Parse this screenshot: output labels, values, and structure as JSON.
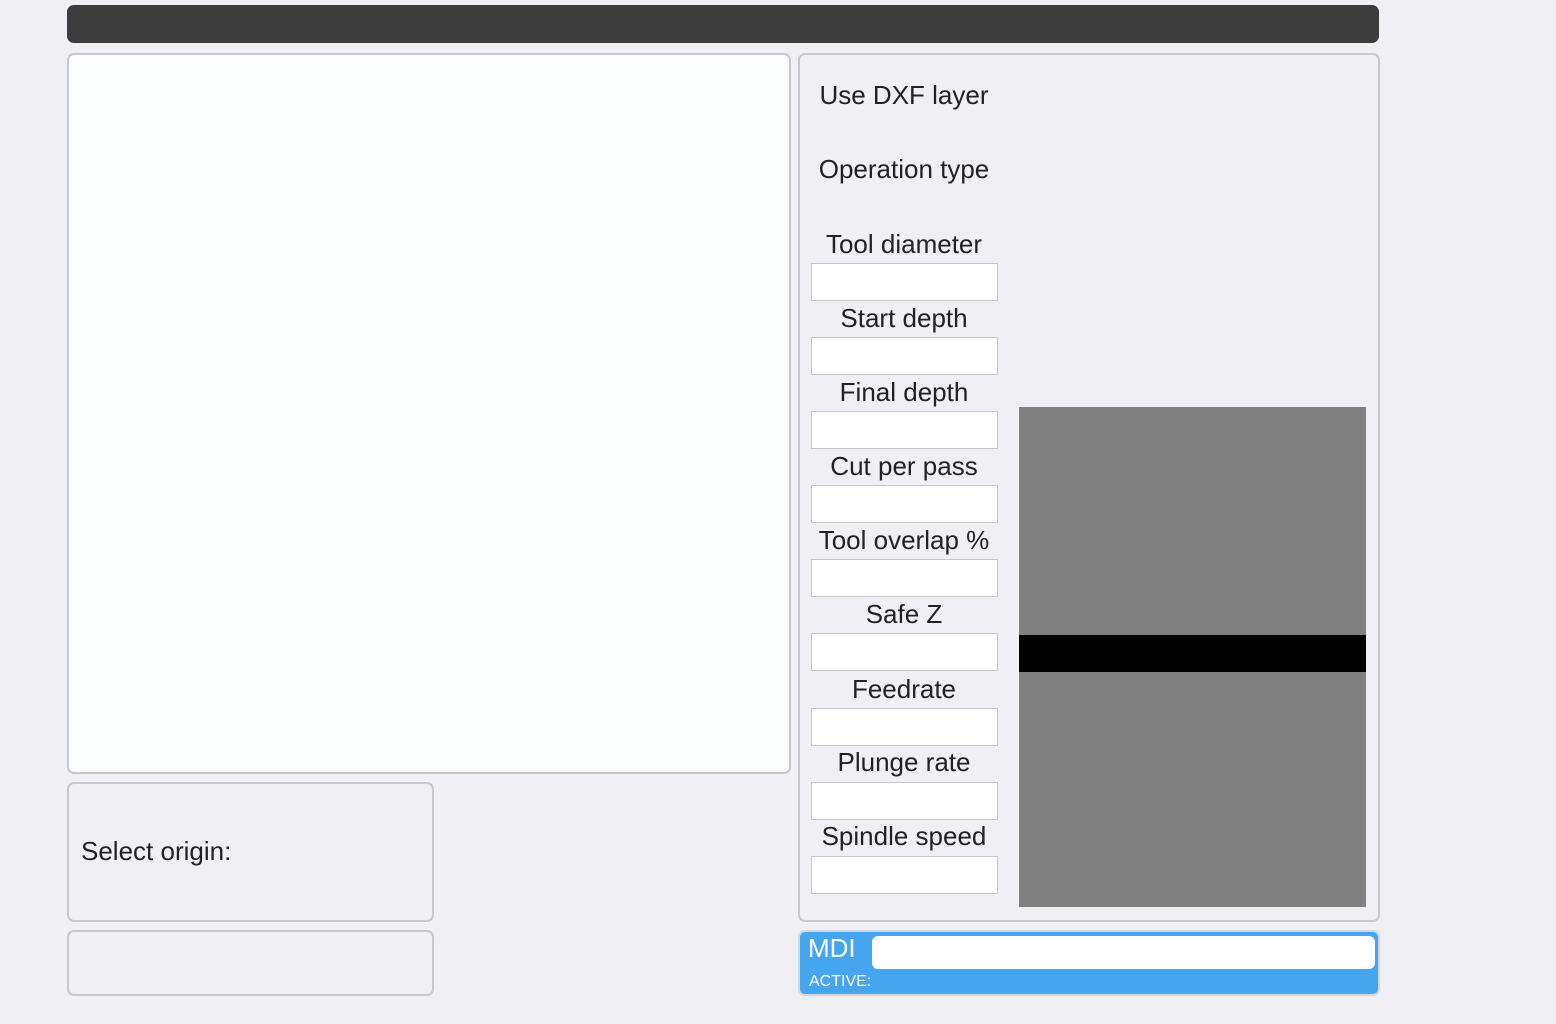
{
  "header": {},
  "origin": {
    "label": "Select origin:"
  },
  "settings": {
    "fields": [
      {
        "label": "Use DXF layer"
      },
      {
        "label": "Operation type"
      },
      {
        "label": "Tool diameter",
        "value": ""
      },
      {
        "label": "Start depth",
        "value": ""
      },
      {
        "label": "Final depth",
        "value": ""
      },
      {
        "label": "Cut per pass",
        "value": ""
      },
      {
        "label": "Tool overlap %",
        "value": ""
      },
      {
        "label": "Safe Z",
        "value": ""
      },
      {
        "label": "Feedrate",
        "value": ""
      },
      {
        "label": "Plunge rate",
        "value": ""
      },
      {
        "label": "Spindle speed",
        "value": ""
      }
    ]
  },
  "mdi": {
    "label": "MDI",
    "value": "",
    "active_label": "ACTIVE:",
    "active_value": ""
  },
  "colors": {
    "background": "#efeff4",
    "topbar": "#3d3d3d",
    "mdi_bar": "#45a5ef",
    "preview_stock": "#808080",
    "preview_cut": "#000000"
  }
}
